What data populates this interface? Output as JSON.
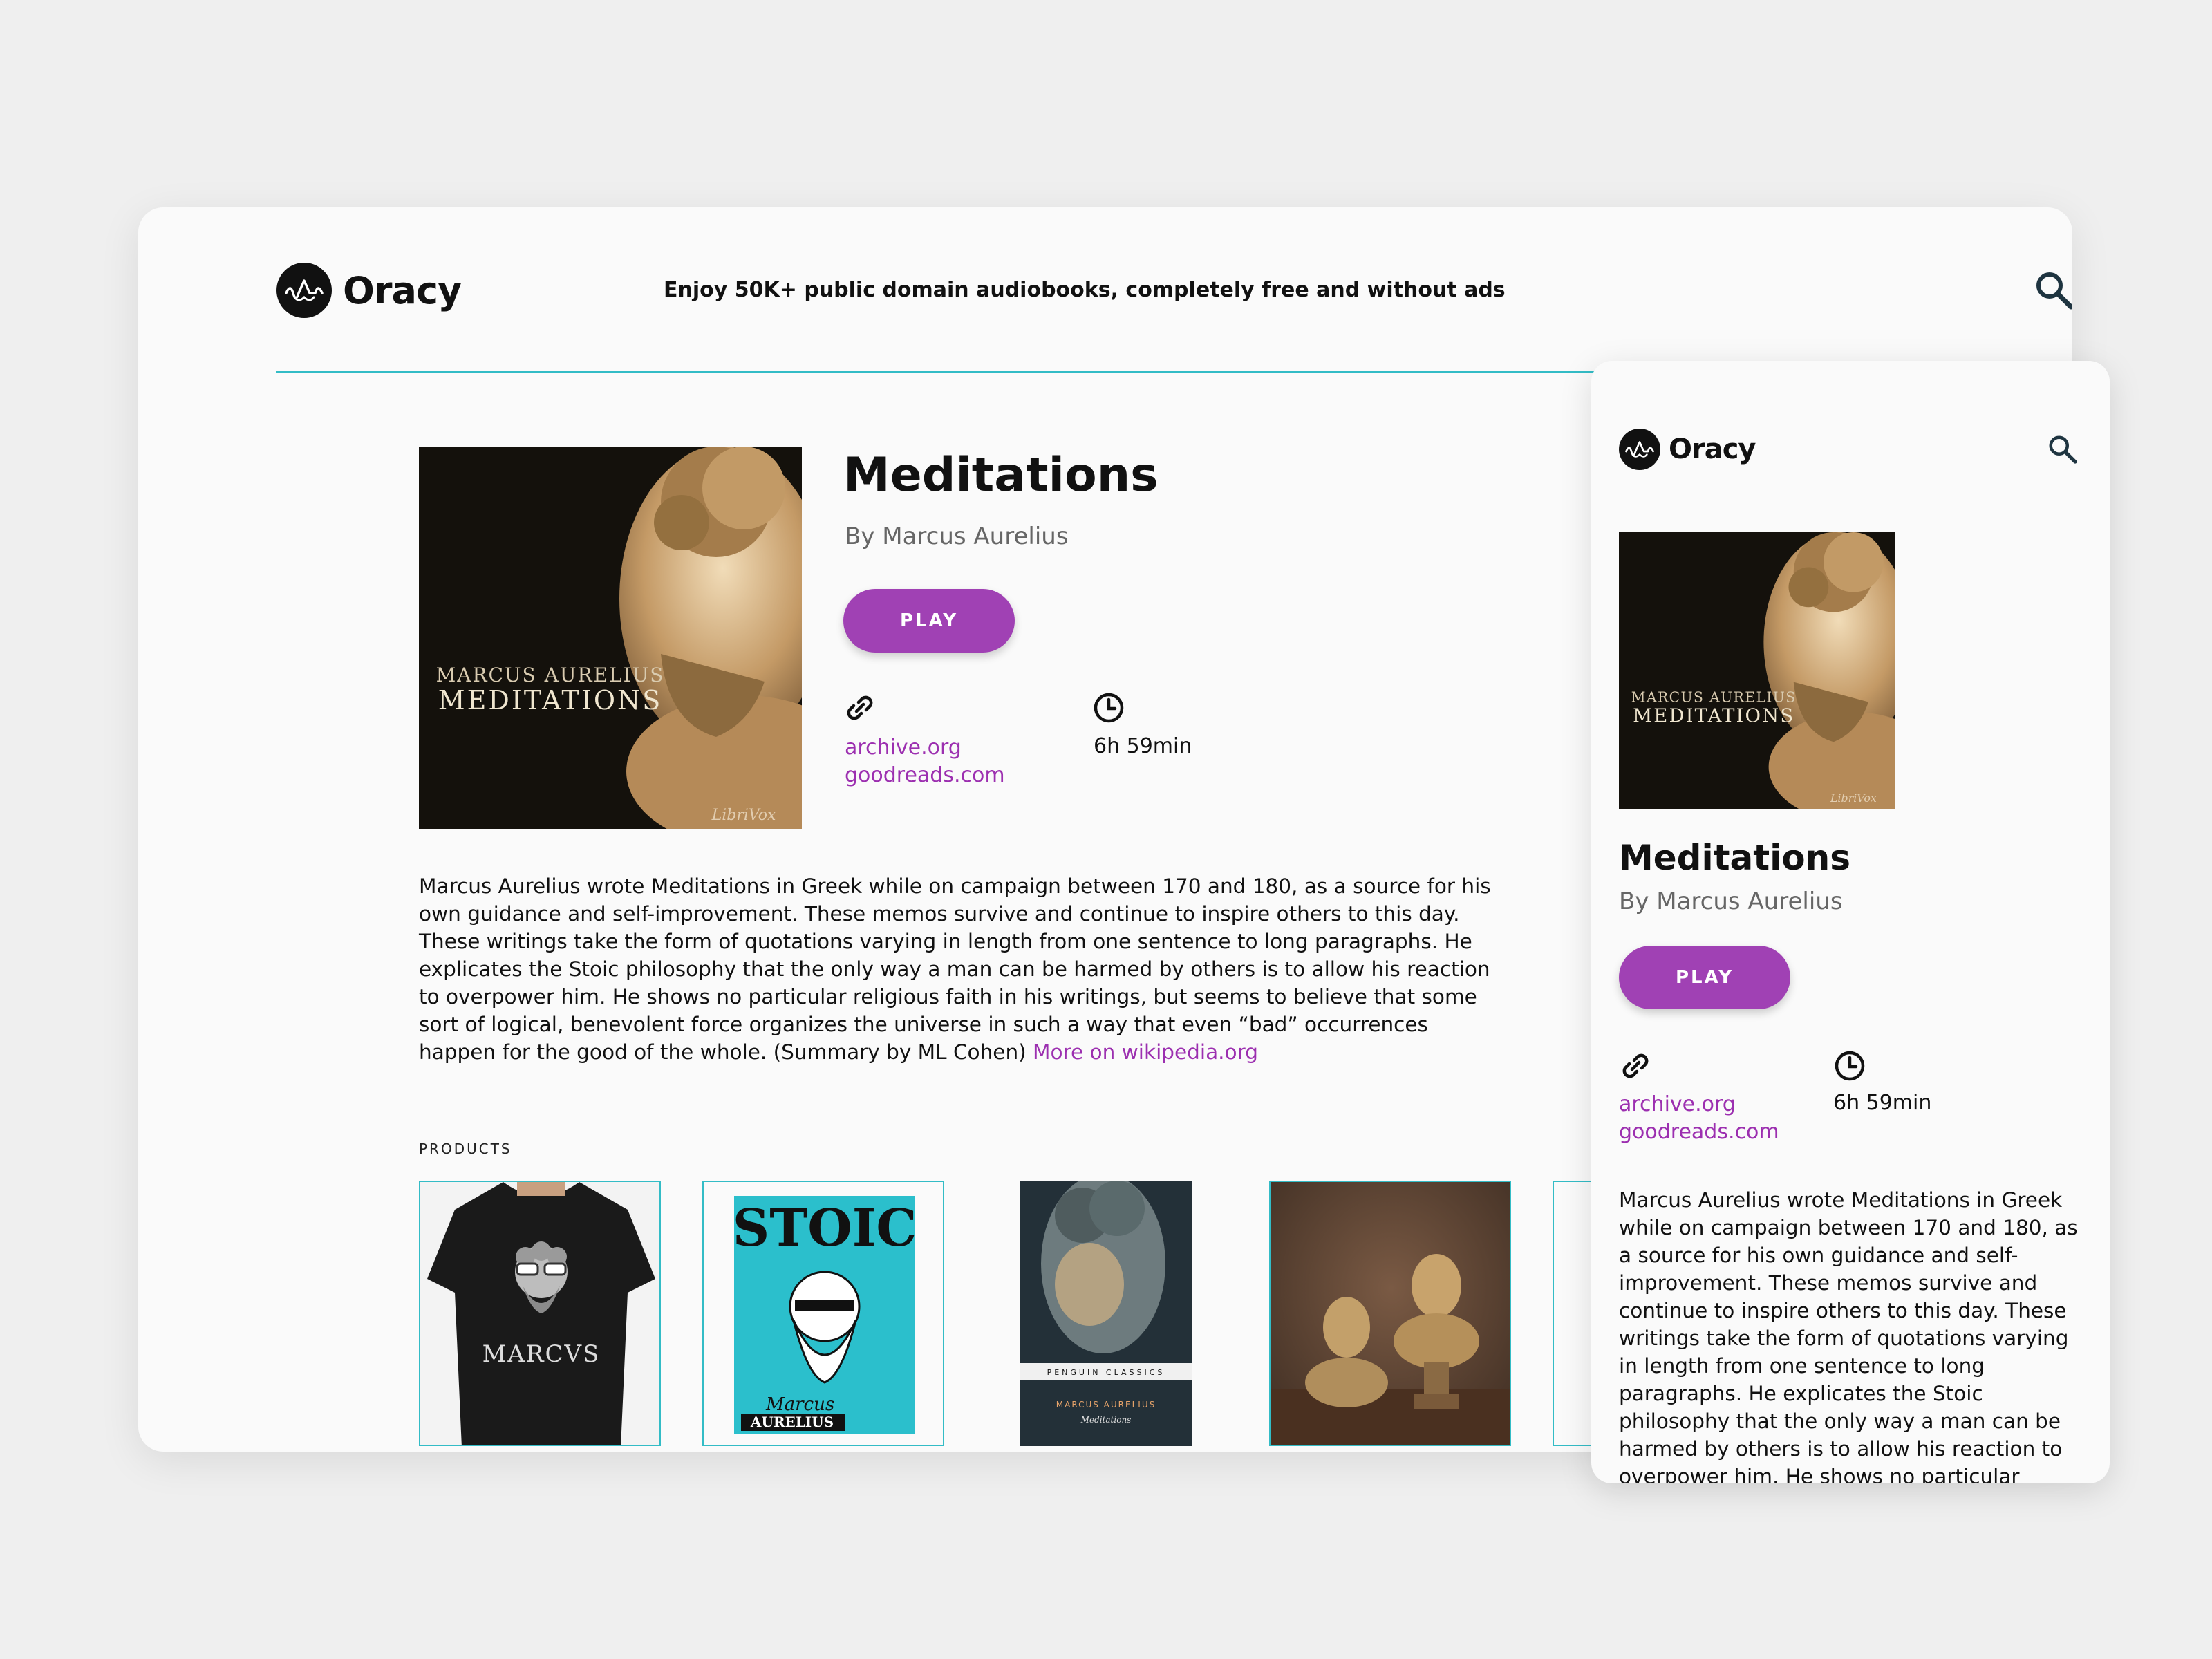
{
  "brand": {
    "name": "Oracy",
    "tagline": "Enjoy 50K+ public domain audiobooks, completely free and without ads"
  },
  "book": {
    "title": "Meditations",
    "author": "By Marcus Aurelius",
    "play_label": "PLAY",
    "links": [
      "archive.org",
      "goodreads.com"
    ],
    "duration": "6h 59min",
    "cover": {
      "line1": "MARCUS AURELIUS",
      "line2": "MEDITATIONS",
      "publisher": "LibriVox"
    },
    "description": "Marcus Aurelius wrote Meditations in Greek while on campaign between 170 and 180, as a source for his own guidance and self-improvement. These memos survive and continue to inspire others to this day. These writings take the form of quotations varying in length from one sentence to long paragraphs. He explicates the Stoic philosophy that the only way a man can be harmed by others is to allow his reaction to overpower him. He shows no particular religious faith in his writings, but seems to believe that some sort of logical, benevolent force organizes the universe in such a way that even “bad” occurrences happen for the good of the whole. (Summary by ML Cohen)",
    "more_link": "More on wikipedia.org",
    "mobile_description": "Marcus Aurelius wrote Meditations in Greek while on campaign between 170 and 180, as a source for his own guidance and self-improvement. These memos survive and continue to inspire others to this day. These writings take the form of quotations varying in length from one sentence to long paragraphs. He explicates the Stoic philosophy that the only way a man can be harmed by others is to allow his reaction to overpower him. He shows no particular"
  },
  "products": {
    "label": "PRODUCTS",
    "items": [
      {
        "name": "tshirt",
        "text": "MARCVS"
      },
      {
        "name": "poster",
        "title": "STOIC",
        "sub": "Marcus",
        "footer": "AURELIUS"
      },
      {
        "name": "book",
        "series": "PENGUIN CLASSICS",
        "author": "MARCUS AURELIUS",
        "title": "Meditations"
      },
      {
        "name": "busts"
      },
      {
        "name": "partial"
      }
    ]
  },
  "colors": {
    "accent": "#a041b4",
    "link": "#9c2fb0",
    "teal": "#33bcc6",
    "text": "#111111",
    "muted": "#666666"
  },
  "icons": [
    "oracy-logo-icon",
    "search-icon",
    "link-icon",
    "clock-icon"
  ]
}
